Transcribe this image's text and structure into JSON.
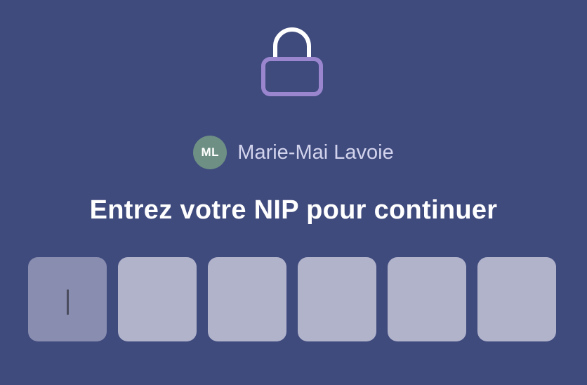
{
  "icon": "lock-icon",
  "colors": {
    "background": "#3f4a7d",
    "lock_shackle": "#ffffff",
    "lock_body": "#9a86cf",
    "avatar_bg": "#6d8f84",
    "pin_box": "#b1b3cb",
    "pin_box_active": "#898daf"
  },
  "user": {
    "initials": "ML",
    "name": "Marie-Mai Lavoie"
  },
  "prompt": "Entrez votre NIP pour continuer",
  "pin": {
    "length": 6,
    "active_index": 0,
    "values": [
      "",
      "",
      "",
      "",
      "",
      ""
    ]
  }
}
